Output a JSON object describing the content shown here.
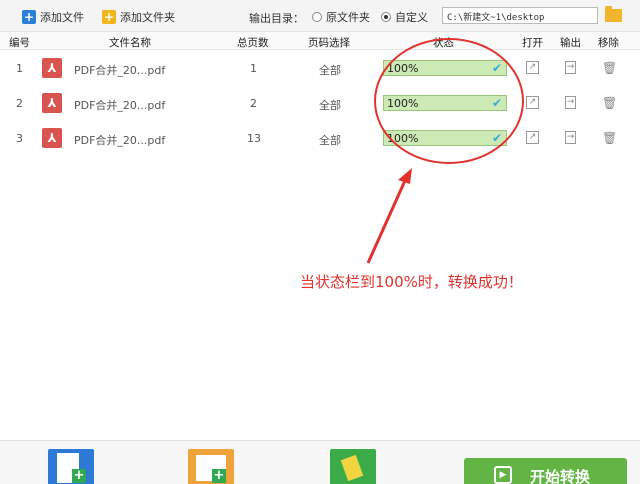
{
  "toolbar": {
    "add_file_label": "添加文件",
    "add_folder_label": "添加文件夹",
    "output_dir_label": "输出目录：",
    "radio_original": "原文件夹",
    "radio_custom": "自定义",
    "path_value": "C:\\新建文~1\\desktop"
  },
  "columns": {
    "index": "编号",
    "filename": "文件名称",
    "pages": "总页数",
    "page_select": "页码选择",
    "status": "状态",
    "open": "打开",
    "output": "输出",
    "remove": "移除"
  },
  "rows": [
    {
      "index": "1",
      "filename": "PDF合并_20...pdf",
      "pages": "1",
      "page_select": "全部",
      "progress": "100%",
      "progress_value": 100
    },
    {
      "index": "2",
      "filename": "PDF合并_20...pdf",
      "pages": "2",
      "page_select": "全部",
      "progress": "100%",
      "progress_value": 100
    },
    {
      "index": "3",
      "filename": "PDF合并_20...pdf",
      "pages": "13",
      "page_select": "全部",
      "progress": "100%",
      "progress_value": 100
    }
  ],
  "annotation": {
    "text": "当状态栏到100%时，转换成功！"
  },
  "bottom": {
    "start_label": "开始转换"
  },
  "colors": {
    "accent_green": "#62b544",
    "progress_fill": "#d8efc6",
    "annotation_red": "#e2322d",
    "pdf_red": "#d9534f"
  },
  "icons": [
    "add-file-icon",
    "add-folder-icon",
    "folder-icon",
    "pdf-icon",
    "check-icon",
    "open-icon",
    "export-icon",
    "trash-icon",
    "play-icon"
  ]
}
